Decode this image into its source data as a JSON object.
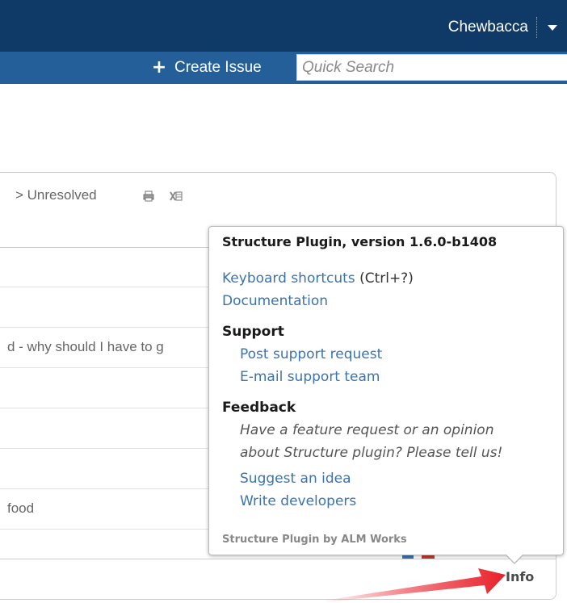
{
  "header": {
    "user_name": "Chewbacca",
    "create_issue_label": "Create Issue",
    "search_placeholder": "Quick Search"
  },
  "filter": {
    "breadcrumb": "> Unresolved"
  },
  "rows": [
    "",
    "",
    "d - why should I have to g",
    "",
    "",
    "",
    "food",
    ""
  ],
  "popup": {
    "title": "Structure Plugin, version 1.6.0-b1408",
    "keyboard_shortcuts": "Keyboard shortcuts",
    "keyboard_shortcut_hint": "(Ctrl+?)",
    "documentation": "Documentation",
    "support_heading": "Support",
    "post_support_request": "Post support request",
    "email_support_team": "E-mail support team",
    "feedback_heading": "Feedback",
    "feedback_line1": "Have a feature request or an opinion",
    "feedback_line2": "about Structure plugin? Please tell us!",
    "suggest_idea": "Suggest an idea",
    "write_developers": "Write developers",
    "footer": "Structure Plugin by ALM Works"
  },
  "info_label": "Info",
  "colors": {
    "header_bg": "#0f3a68",
    "subheader_bg": "#245f9a",
    "link": "#3b73af",
    "annotation_arrow": "#e8202a"
  },
  "icons": {
    "user_menu": "chevron-down-icon",
    "create": "plus-icon",
    "print": "print-icon",
    "export": "excel-icon",
    "annotation": "red-arrow-icon"
  }
}
